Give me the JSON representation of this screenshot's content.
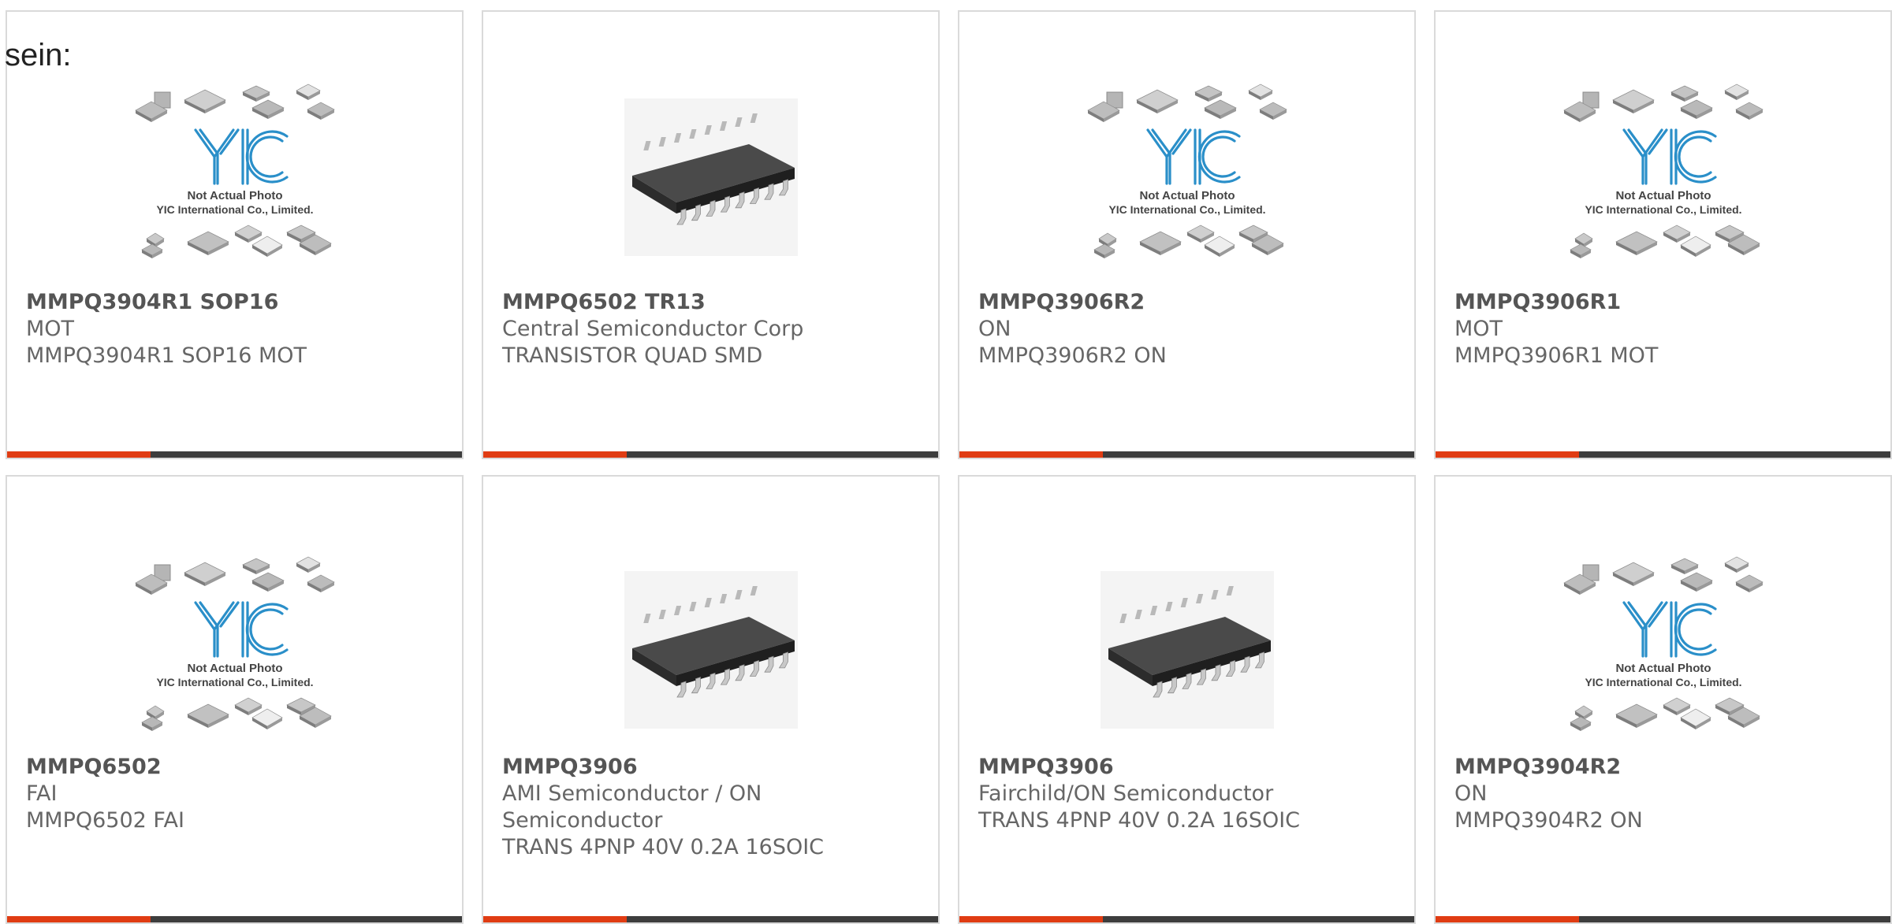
{
  "intro_text": "sein:",
  "placeholder": {
    "line1": "Not Actual Photo",
    "line2": "YIC International Co., Limited."
  },
  "products": [
    {
      "part": "MMPQ3904R1 SOP16",
      "maker": "MOT",
      "desc": "MMPQ3904R1 SOP16 MOT",
      "image": "yic-placeholder"
    },
    {
      "part": "MMPQ6502 TR13",
      "maker": "Central Semiconductor Corp",
      "desc": "TRANSISTOR QUAD SMD",
      "image": "soic16-chip"
    },
    {
      "part": "MMPQ3906R2",
      "maker": "ON",
      "desc": "MMPQ3906R2 ON",
      "image": "yic-placeholder"
    },
    {
      "part": "MMPQ3906R1",
      "maker": "MOT",
      "desc": "MMPQ3906R1 MOT",
      "image": "yic-placeholder"
    },
    {
      "part": "MMPQ6502",
      "maker": "FAI",
      "desc": "MMPQ6502 FAI",
      "image": "yic-placeholder"
    },
    {
      "part": "MMPQ3906",
      "maker": "AMI Semiconductor / ON Semiconductor",
      "desc": "TRANS 4PNP 40V 0.2A 16SOIC",
      "image": "soic16-chip"
    },
    {
      "part": "MMPQ3906",
      "maker": "Fairchild/ON Semiconductor",
      "desc": "TRANS 4PNP 40V 0.2A 16SOIC",
      "image": "soic16-chip"
    },
    {
      "part": "MMPQ3904R2",
      "maker": "ON",
      "desc": "MMPQ3904R2 ON",
      "image": "yic-placeholder"
    }
  ],
  "colors": {
    "accent": "#e03c13",
    "bar": "#3d3d3d",
    "border": "#dadada",
    "logo": "#2a8fc9"
  }
}
